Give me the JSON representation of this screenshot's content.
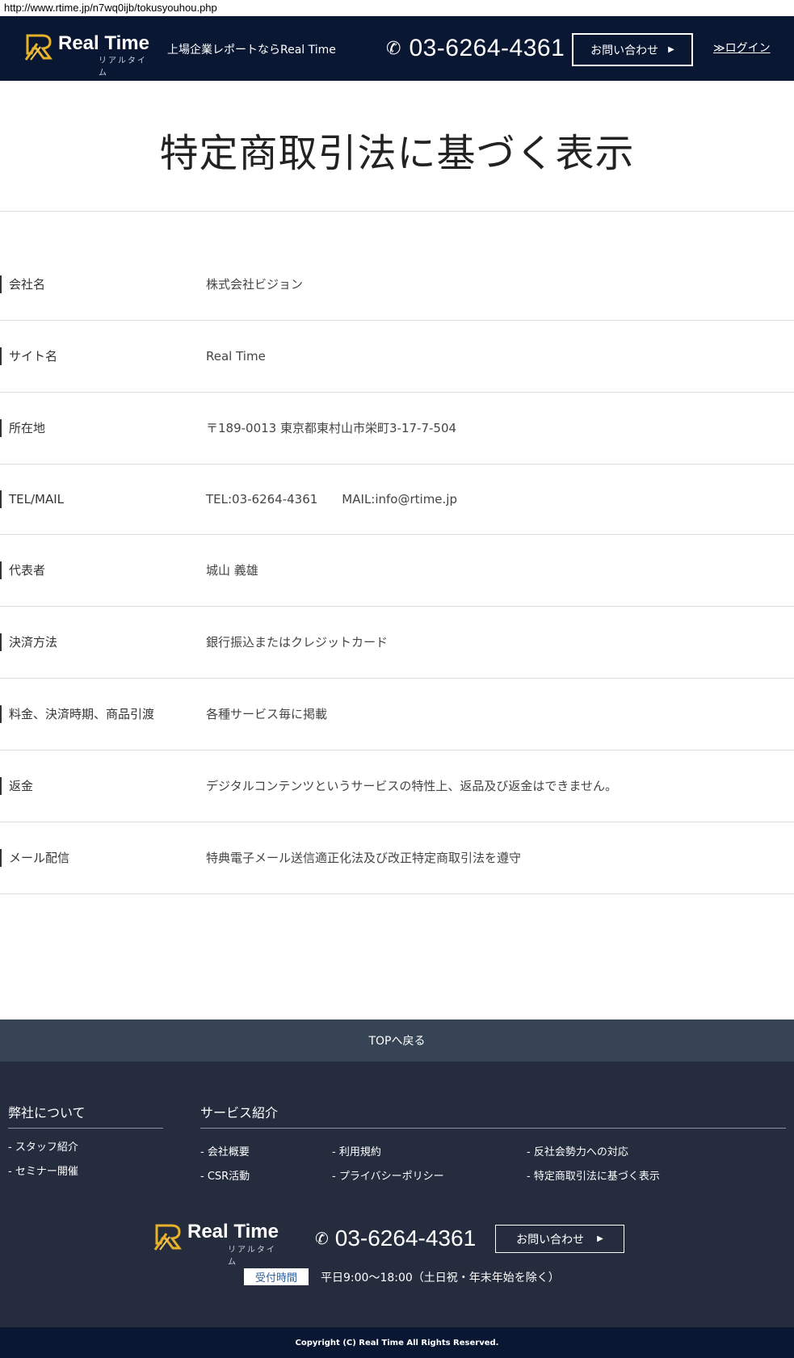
{
  "browser": {
    "url": "http://www.rtime.jp/n7wq0ijb/tokusyouhou.php"
  },
  "header": {
    "logo_main": "Real Time",
    "logo_sub": "リアルタイム",
    "tagline": "上場企業レポートならReal Time",
    "phone": "03-6264-4361",
    "contact_label": "お問い合わせ",
    "login_label": "≫ログイン"
  },
  "page": {
    "title": "特定商取引法に基づく表示"
  },
  "info": {
    "rows": [
      {
        "label": "会社名",
        "value": "株式会社ビジョン"
      },
      {
        "label": "サイト名",
        "value": "Real Time"
      },
      {
        "label": "所在地",
        "value": "〒189-0013 東京都東村山市栄町3-17-7-504"
      },
      {
        "label": "TEL/MAIL",
        "value": "TEL:03-6264-4361　　MAIL:info@rtime.jp"
      },
      {
        "label": "代表者",
        "value": "城山 義雄"
      },
      {
        "label": "決済方法",
        "value": "銀行振込またはクレジットカード"
      },
      {
        "label": "料金、決済時期、商品引渡",
        "value": "各種サービス毎に掲載"
      },
      {
        "label": "返金",
        "value": "デジタルコンテンツというサービスの特性上、返品及び返金はできません。"
      },
      {
        "label": "メール配信",
        "value": "特典電子メール送信適正化法及び改正特定商取引法を遵守"
      }
    ]
  },
  "top_button": "TOPへ戻る",
  "footer": {
    "col1": {
      "heading": "弊社について",
      "links": [
        "- スタッフ紹介",
        "- セミナー開催"
      ]
    },
    "col2": {
      "heading": "サービス紹介",
      "links": [
        "- 会社概要",
        "- 利用規約",
        "- 反社会勢力への対応",
        "- CSR活動",
        "- プライバシーポリシー",
        "- 特定商取引法に基づく表示"
      ]
    },
    "logo_main": "Real Time",
    "logo_sub": "リアルタイム",
    "phone": "03-6264-4361",
    "contact_label": "お問い合わせ",
    "hours_badge": "受付時間",
    "hours_text": "平日9:00〜18:00（土日祝・年末年始を除く）"
  },
  "copyright": "Copyright (C) Real Time All Rights Reserved.",
  "colors": {
    "navy": "#091733",
    "footer": "#242c3e",
    "top_button": "#364455",
    "logo_gold": "#e8b12a"
  }
}
